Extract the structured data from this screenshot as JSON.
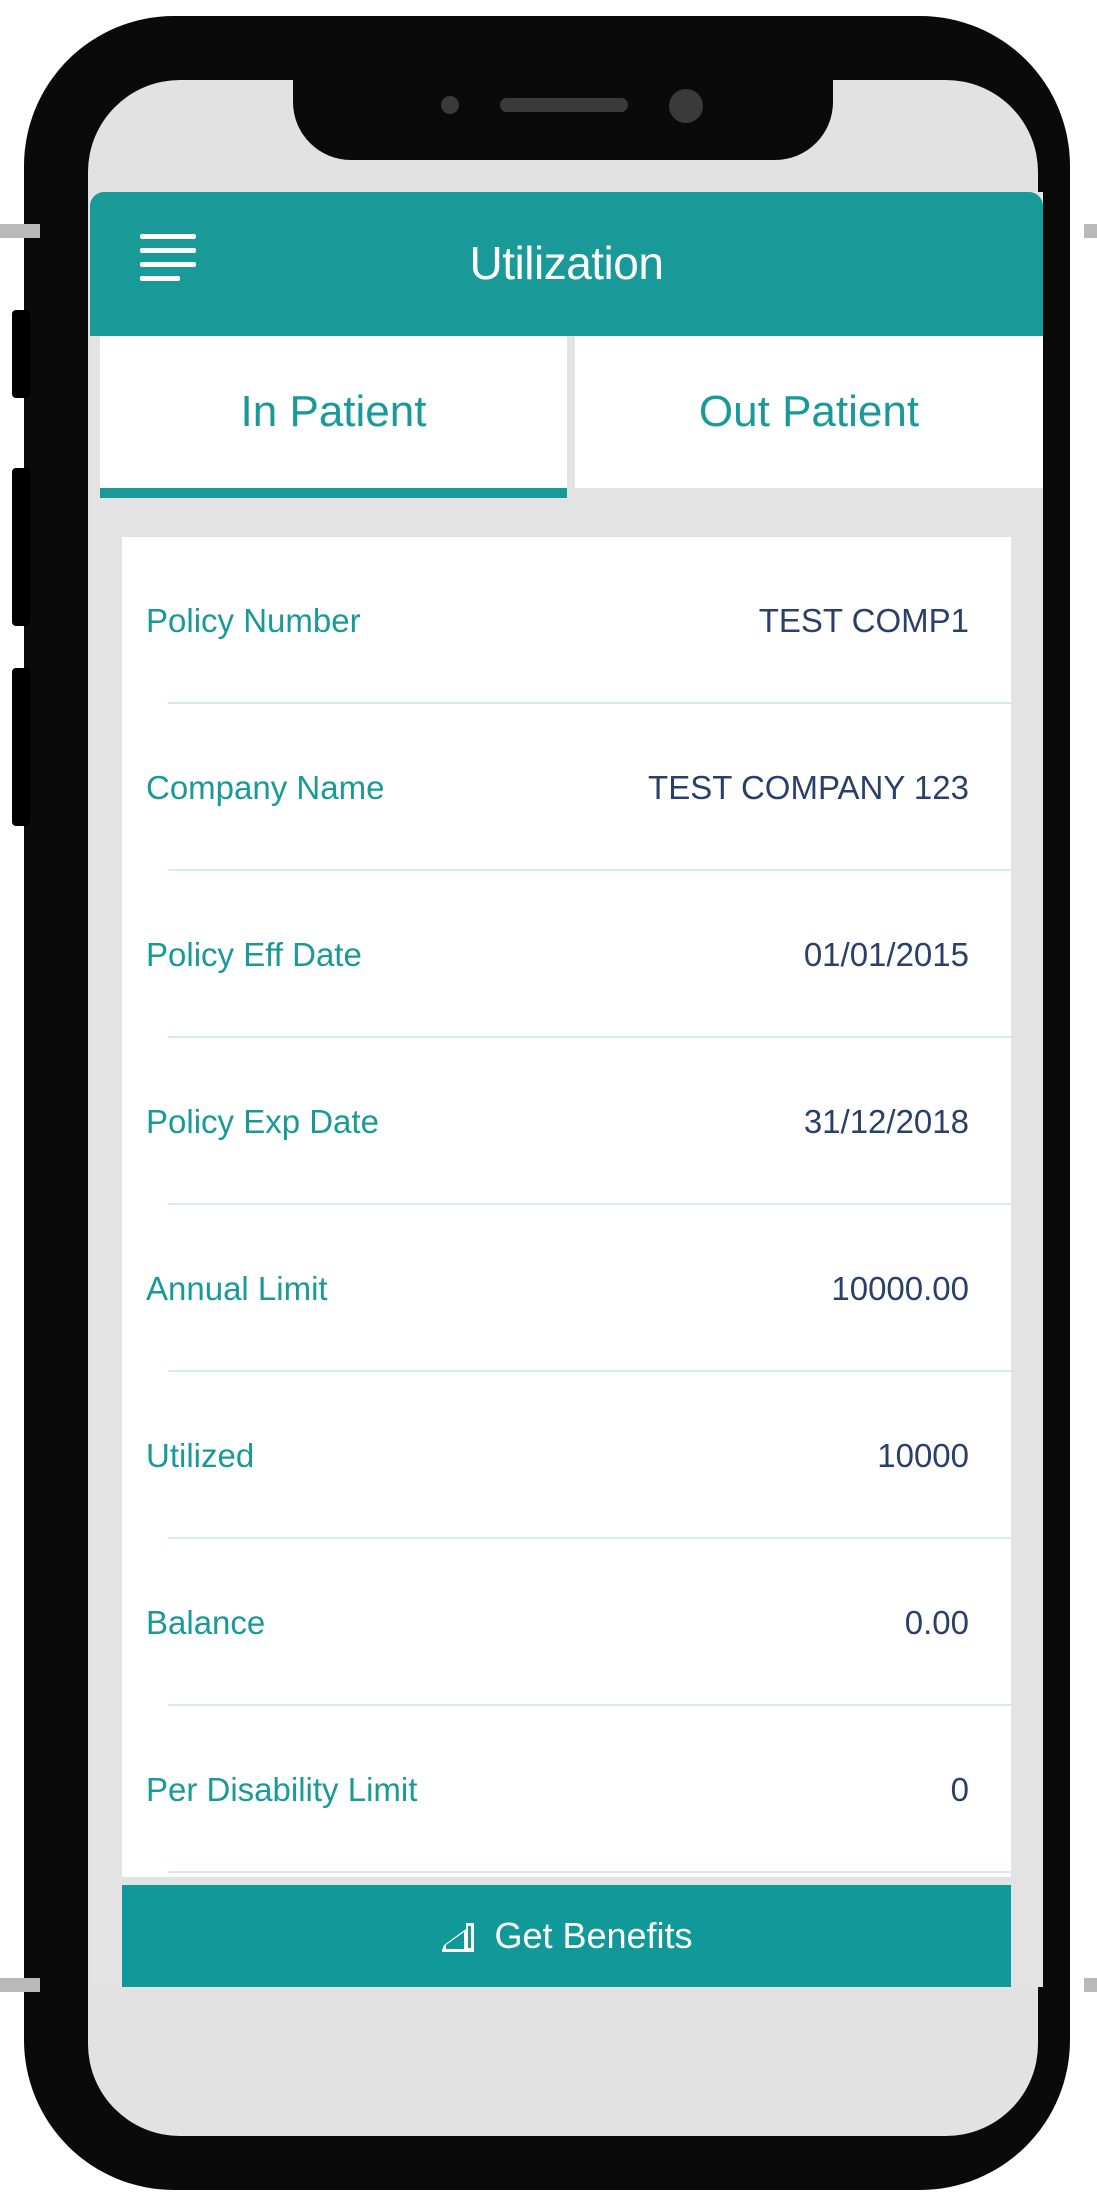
{
  "header": {
    "title": "Utilization",
    "menu_icon": "hamburger-menu-icon"
  },
  "tabs": [
    {
      "label": "In Patient",
      "active": true
    },
    {
      "label": "Out Patient",
      "active": false
    }
  ],
  "policy_rows": [
    {
      "label": "Policy Number",
      "value": "TEST COMP1"
    },
    {
      "label": "Company Name",
      "value": "TEST COMPANY 123"
    },
    {
      "label": "Policy Eff Date",
      "value": "01/01/2015"
    },
    {
      "label": "Policy Exp Date",
      "value": "31/12/2018"
    },
    {
      "label": "Annual Limit",
      "value": "10000.00"
    },
    {
      "label": "Utilized",
      "value": "10000"
    },
    {
      "label": "Balance",
      "value": "0.00"
    },
    {
      "label": "Per Disability Limit",
      "value": "0"
    }
  ],
  "footer_button": {
    "label": "Get Benefits",
    "icon": "chart-bar-icon"
  },
  "colors": {
    "primary": "#1a9999",
    "value_text": "#2b3f6b",
    "background": "#e3e3e3"
  }
}
